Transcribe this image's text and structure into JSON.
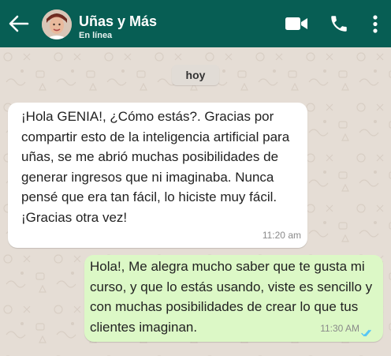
{
  "header": {
    "title": "Uñas y Más",
    "status": "En línea"
  },
  "chat": {
    "date_label": "hoy",
    "messages": [
      {
        "direction": "incoming",
        "text": "¡Hola GENIA!, ¿Cómo estás?. Gracias por compartir esto de la inteligencia artificial para uñas, se me abrió muchas posibilidades de generar ingresos que ni imaginaba. Nunca pensé que era tan fácil, lo hiciste muy fácil. ¡Gracias otra vez!",
        "time": "11:20 am"
      },
      {
        "direction": "outgoing",
        "text": "Hola!, Me alegra mucho saber que te gusta mi curso, y que lo estás usando, viste es sencillo y con muchas posibilidades de crear lo que tus clientes imaginan.",
        "time": "11:30 AM",
        "read_status": "read"
      }
    ]
  },
  "colors": {
    "header": "#075e54",
    "incoming_bubble": "#ffffff",
    "outgoing_bubble": "#dcf8c6",
    "read_ticks": "#4fc3f7"
  },
  "icons": [
    "back-arrow-icon",
    "video-call-icon",
    "phone-icon",
    "more-vertical-icon",
    "double-check-icon"
  ]
}
